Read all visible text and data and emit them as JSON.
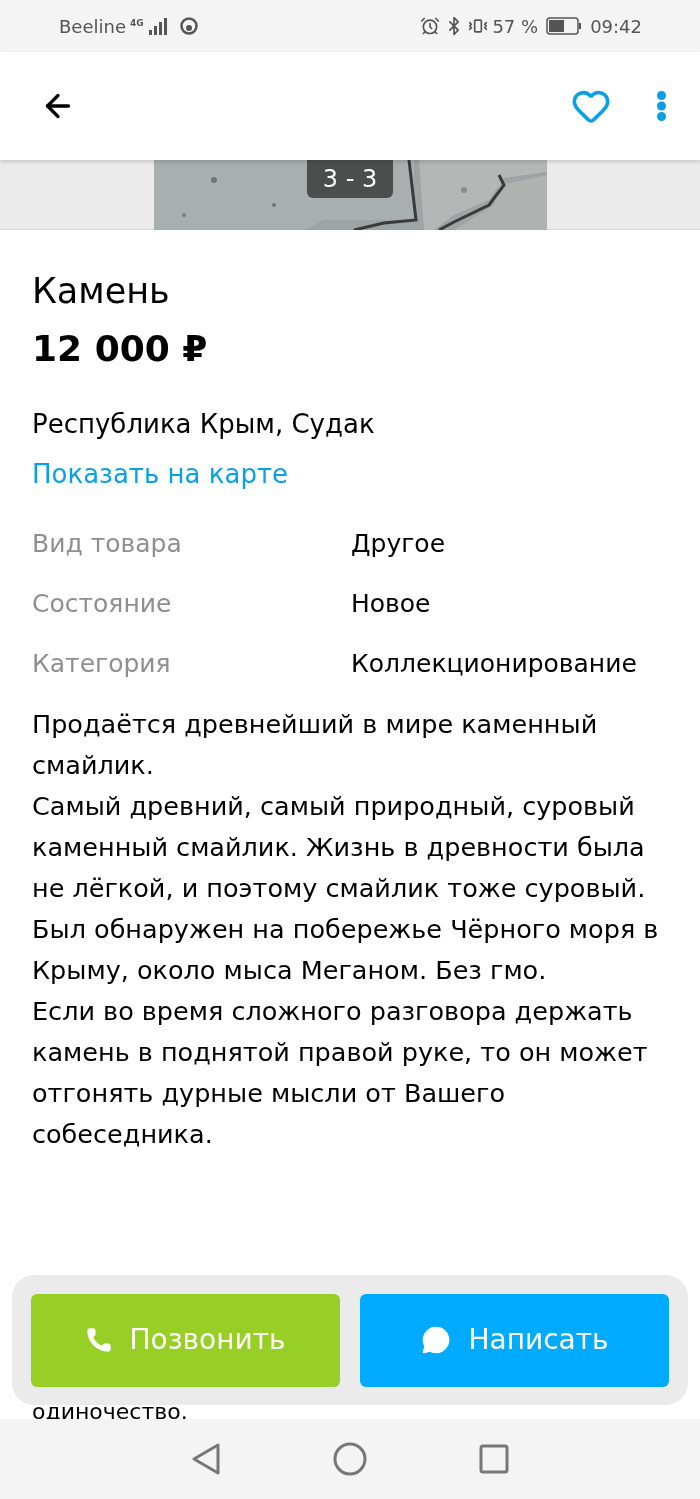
{
  "status_bar": {
    "carrier": "Beeline",
    "network": "4G",
    "battery": "57 %",
    "time": "09:42"
  },
  "gallery": {
    "counter": "3 - 3"
  },
  "listing": {
    "title": "Камень",
    "price": "12 000 ₽",
    "location": "Республика Крым, Судак",
    "map_link": "Показать на карте"
  },
  "specs": [
    {
      "label": "Вид товара",
      "value": "Другое"
    },
    {
      "label": "Состояние",
      "value": "Новое"
    },
    {
      "label": "Категория",
      "value": "Коллекционирование"
    }
  ],
  "description": [
    "Продаётся древнейший в мире каменный смайлик.",
    "Самый древний, самый природный, суровый каменный смайлик. Жизнь в древности была не лёгкой, и поэтому смайлик тоже суровый.",
    "Был обнаружен на побережье Чёрного моря в Крыму, около мыса Меганом. Без гмо.",
    "Если во время сложного разговора держать камень в поднятой правой руке, то он может отгонять дурные мысли от Вашего собеседника."
  ],
  "description_tail": "одиночество.",
  "actions": [
    {
      "kind": "call",
      "label": "Позвонить"
    },
    {
      "kind": "message",
      "label": "Написать"
    }
  ]
}
